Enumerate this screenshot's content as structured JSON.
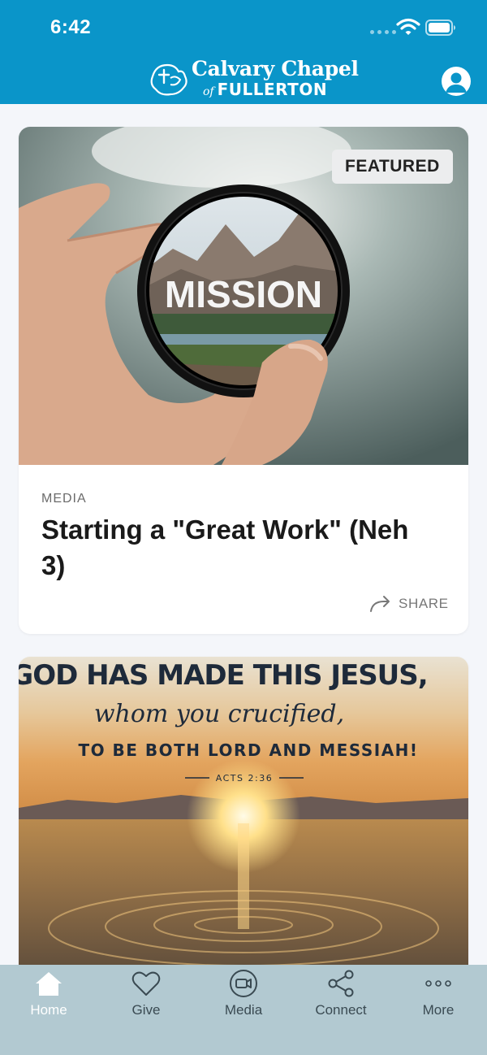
{
  "status_bar": {
    "time": "6:42"
  },
  "brand": {
    "line1": "Calvary Chapel",
    "of": "of",
    "line2": "FULLERTON"
  },
  "colors": {
    "header": "#0a95c9",
    "tabbar": "#b2c9d1",
    "background": "#f4f6fa"
  },
  "feed": [
    {
      "badge": "FEATURED",
      "image_text": "MISSION",
      "category": "MEDIA",
      "title": "Starting a \"Great Work\"  (Neh 3)",
      "share_label": "SHARE"
    },
    {
      "image_lines": [
        "GOD HAS MADE THIS JESUS,",
        "whom you crucified,",
        "TO BE BOTH LORD AND MESSIAH!",
        "ACTS 2:36"
      ]
    }
  ],
  "tabs": [
    {
      "label": "Home",
      "icon": "home-icon",
      "active": true
    },
    {
      "label": "Give",
      "icon": "heart-icon",
      "active": false
    },
    {
      "label": "Media",
      "icon": "video-icon",
      "active": false
    },
    {
      "label": "Connect",
      "icon": "share-nodes-icon",
      "active": false
    },
    {
      "label": "More",
      "icon": "more-dots-icon",
      "active": false
    }
  ]
}
